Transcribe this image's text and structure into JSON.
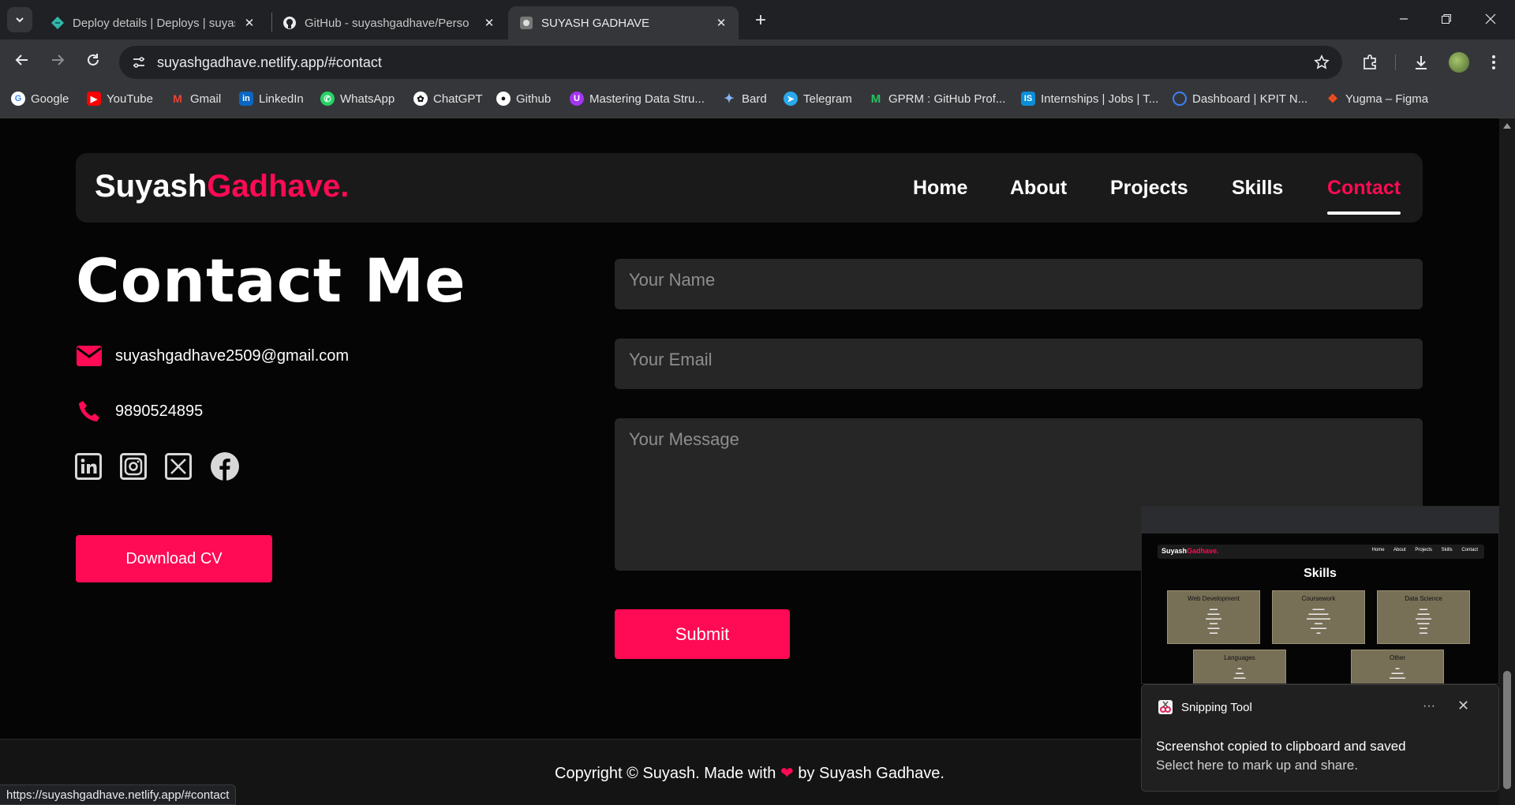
{
  "browser": {
    "tabs": [
      {
        "title": "Deploy details | Deploys | suyas",
        "favicon": "netlify-icon"
      },
      {
        "title": "GitHub - suyashgadhave/Perso",
        "favicon": "github-icon"
      },
      {
        "title": "SUYASH GADHAVE",
        "favicon": "site-icon"
      }
    ],
    "url": "suyashgadhave.netlify.app/#contact",
    "bookmarks": [
      "Google",
      "YouTube",
      "Gmail",
      "LinkedIn",
      "WhatsApp",
      "ChatGPT",
      "Github",
      "Mastering Data Stru...",
      "Bard",
      "Telegram",
      "GPRM : GitHub Prof...",
      "Internships | Jobs | T...",
      "Dashboard | KPIT N...",
      "Yugma – Figma"
    ],
    "status_url": "https://suyashgadhave.netlify.app/#contact"
  },
  "site": {
    "brand_first": "Suyash",
    "brand_second": "Gadhave.",
    "nav": [
      "Home",
      "About",
      "Projects",
      "Skills",
      "Contact"
    ],
    "active_nav": "Contact",
    "accent_color": "#ff0a54"
  },
  "contact": {
    "title": "Contact Me",
    "email": "suyashgadhave2509@gmail.com",
    "phone": "9890524895",
    "social": [
      "linkedin-icon",
      "instagram-icon",
      "x-icon",
      "facebook-icon"
    ],
    "download_cv": "Download CV"
  },
  "form": {
    "name_placeholder": "Your Name",
    "email_placeholder": "Your Email",
    "message_placeholder": "Your Message",
    "submit": "Submit"
  },
  "footer": {
    "before_heart": "Copyright © Suyash. Made with",
    "after_heart": "by Suyash Gadhave."
  },
  "snip_preview": {
    "brand_first": "Suyash",
    "brand_second": "Gadhave.",
    "nav": "Home About Projects Skills Contact",
    "title": "Skills",
    "cards": [
      "Web Development",
      "Coursework",
      "Data Science",
      "Languages",
      "Other"
    ]
  },
  "toast": {
    "app": "Snipping Tool",
    "line1": "Screenshot copied to clipboard and saved",
    "line2": "Select here to mark up and share."
  }
}
